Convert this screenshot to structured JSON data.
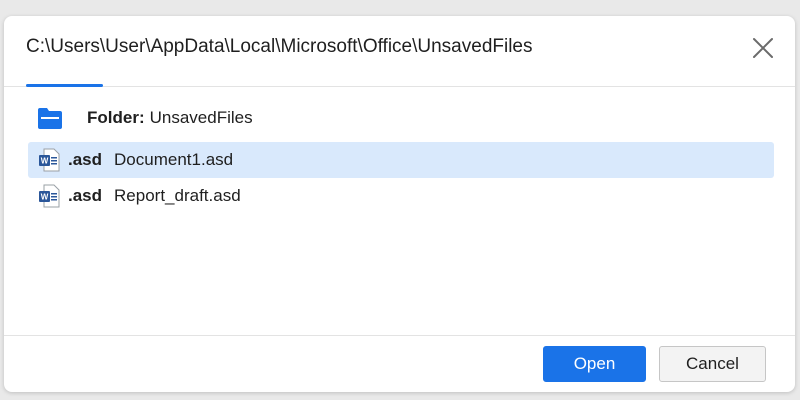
{
  "dialog": {
    "path": "C:\\Users\\User\\AppData\\Local\\Microsoft\\Office\\UnsavedFiles",
    "close_icon": "close-icon"
  },
  "folder": {
    "icon": "folder-icon",
    "label": "Folder:",
    "name": "UnsavedFiles"
  },
  "files": [
    {
      "icon": "word-document-icon",
      "ext": ".asd",
      "name": "Document1.asd",
      "selected": true
    },
    {
      "icon": "word-document-icon",
      "ext": ".asd",
      "name": "Report_draft.asd",
      "selected": false
    }
  ],
  "buttons": {
    "open_label": "Open",
    "cancel_label": "Cancel"
  },
  "colors": {
    "accent": "#1a73e8",
    "selection": "#d9e9fc",
    "word_blue": "#2b579a"
  }
}
